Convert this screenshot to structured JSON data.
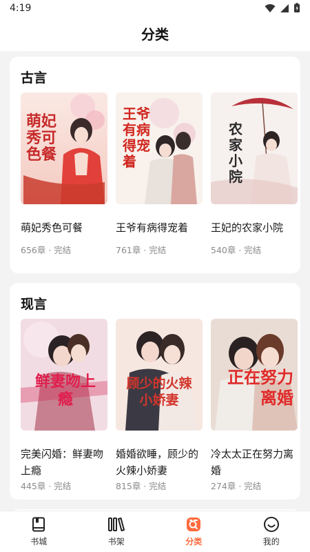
{
  "status_bar": {
    "time": "4:19"
  },
  "header": {
    "title": "分类"
  },
  "sections": [
    {
      "title": "古言",
      "books": [
        {
          "title": "萌妃秀色可餐",
          "chapters": "656章",
          "status": "完结",
          "cover_text": "萌妃秀可色餐"
        },
        {
          "title": "王爷有病得宠着",
          "chapters": "761章",
          "status": "完结",
          "cover_text": "王爷有病得宠着"
        },
        {
          "title": "王妃的农家小院",
          "chapters": "540章",
          "status": "完结",
          "cover_text": "农家小院"
        }
      ]
    },
    {
      "title": "现言",
      "books": [
        {
          "title": "完美闪婚：鲜妻吻上瘾",
          "chapters": "445章",
          "status": "完结",
          "cover_text": "鲜妻吻上瘾"
        },
        {
          "title": "婚婚欲睡，顾少的火辣小娇妻",
          "chapters": "815章",
          "status": "完结",
          "cover_text": "顾少的火辣小娇妻"
        },
        {
          "title": "冷太太正在努力离婚",
          "chapters": "274章",
          "status": "完结",
          "cover_text": "正在努力离婚"
        }
      ]
    }
  ],
  "nav": [
    {
      "label": "书城",
      "icon": "book-icon",
      "active": false
    },
    {
      "label": "书架",
      "icon": "shelf-icon",
      "active": false
    },
    {
      "label": "分类",
      "icon": "category-icon",
      "active": true
    },
    {
      "label": "我的",
      "icon": "smiley-icon",
      "active": false
    }
  ],
  "colors": {
    "accent": "#ff6a3d",
    "background": "#f3f3f3",
    "card": "#ffffff",
    "meta": "#8a8a8a"
  }
}
